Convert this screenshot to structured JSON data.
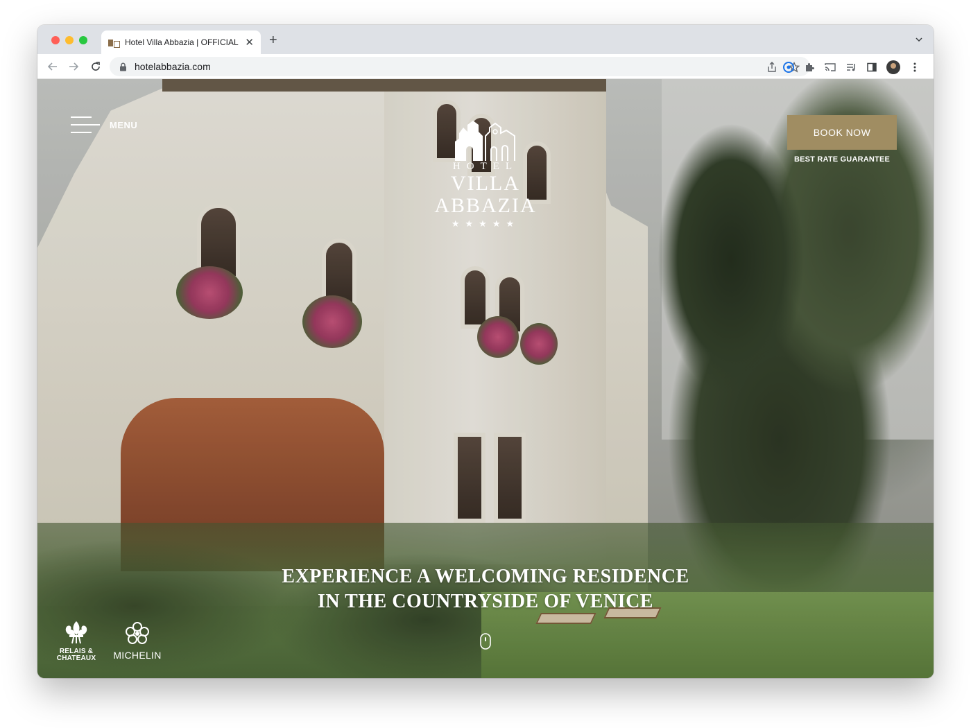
{
  "browser": {
    "tab_title": "Hotel Villa Abbazia | OFFICIAL",
    "new_tab_label": "+",
    "url": "hotelabbazia.com"
  },
  "hero": {
    "menu_label": "MENU",
    "logo": {
      "top_word": "HOTEL",
      "name": "VILLA ABBAZIA",
      "stars": "★★★★★"
    },
    "book_button_label": "BOOK NOW",
    "best_rate_label": "BEST RATE GUARANTEE",
    "headline_line1": "EXPERIENCE A WELCOMING RESIDENCE",
    "headline_line2": "IN THE COUNTRYSIDE OF VENICE",
    "badges": {
      "relais_line1": "RELAIS &",
      "relais_line2": "CHATEAUX",
      "michelin": "MICHELIN"
    }
  },
  "colors": {
    "book_button_bg": "#a08d62",
    "tab_strip": "#dee1e6"
  }
}
